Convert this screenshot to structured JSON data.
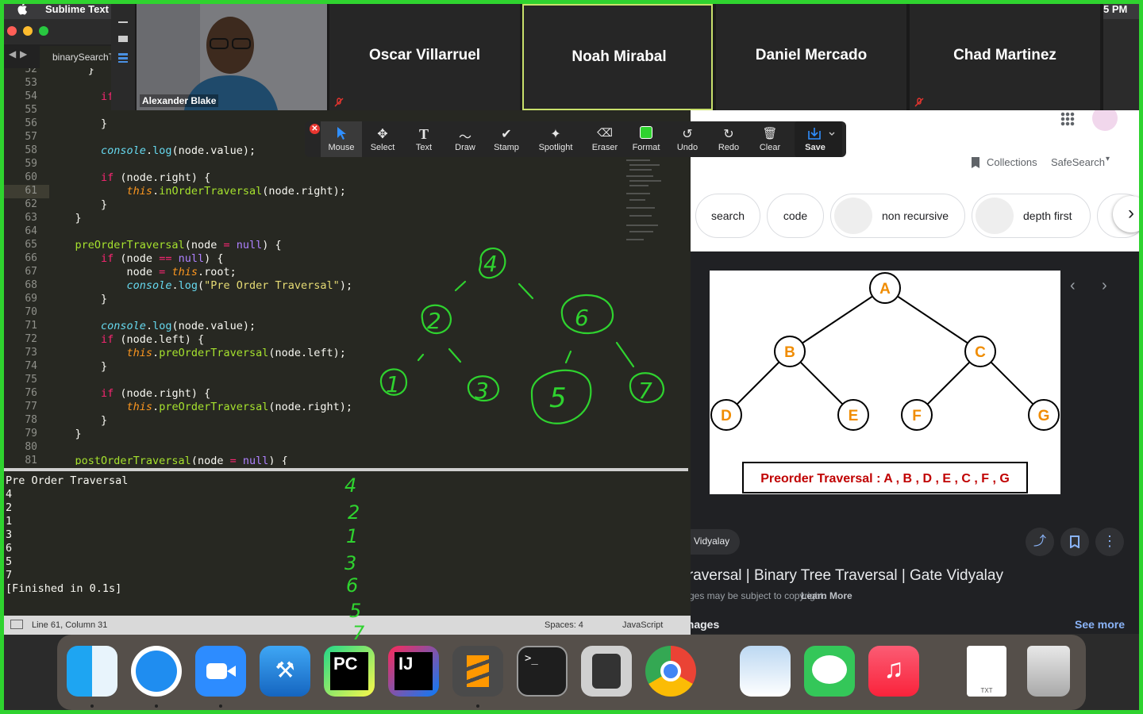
{
  "menubar": {
    "app_name": "Sublime Text",
    "clock": "5 PM"
  },
  "sublime": {
    "tab_label": "binarySearchTree.js",
    "nav_back": "◀",
    "nav_forward": "▶",
    "status_left": "Line 61, Column 31",
    "status_spaces": "Spaces: 4",
    "status_syntax": "JavaScript"
  },
  "code_lines": [
    {
      "n": "52",
      "t": "      }"
    },
    {
      "n": "53",
      "t": ""
    },
    {
      "n": "54",
      "t": "        if"
    },
    {
      "n": "55",
      "t": ""
    },
    {
      "n": "56",
      "t": "        }"
    },
    {
      "n": "57",
      "t": ""
    },
    {
      "n": "58",
      "t": "        console.log(node.value);"
    },
    {
      "n": "59",
      "t": ""
    },
    {
      "n": "60",
      "t": "        if (node.right) {"
    },
    {
      "n": "61",
      "t": "            this.inOrderTraversal(node.right);"
    },
    {
      "n": "62",
      "t": "        }"
    },
    {
      "n": "63",
      "t": "    }"
    },
    {
      "n": "64",
      "t": ""
    },
    {
      "n": "65",
      "t": "    preOrderTraversal(node = null) {"
    },
    {
      "n": "66",
      "t": "        if (node == null) {"
    },
    {
      "n": "67",
      "t": "            node = this.root;"
    },
    {
      "n": "68",
      "t": "            console.log(\"Pre Order Traversal\");"
    },
    {
      "n": "69",
      "t": "        }"
    },
    {
      "n": "70",
      "t": ""
    },
    {
      "n": "71",
      "t": "        console.log(node.value);"
    },
    {
      "n": "72",
      "t": "        if (node.left) {"
    },
    {
      "n": "73",
      "t": "            this.preOrderTraversal(node.left);"
    },
    {
      "n": "74",
      "t": "        }"
    },
    {
      "n": "75",
      "t": ""
    },
    {
      "n": "76",
      "t": "        if (node.right) {"
    },
    {
      "n": "77",
      "t": "            this.preOrderTraversal(node.right);"
    },
    {
      "n": "78",
      "t": "        }"
    },
    {
      "n": "79",
      "t": "    }"
    },
    {
      "n": "80",
      "t": ""
    },
    {
      "n": "81",
      "t": "    postOrderTraversal(node = null) {"
    }
  ],
  "output_lines": [
    "Pre Order Traversal",
    "4",
    "2",
    "1",
    "3",
    "6",
    "5",
    "7",
    "[Finished in 0.1s]"
  ],
  "handwriting": {
    "tree_nodes": [
      "4",
      "2",
      "6",
      "1",
      "3",
      "5",
      "7"
    ],
    "sequence": [
      "4",
      "2",
      "1",
      "3",
      "6",
      "5",
      "7"
    ],
    "color": "#2fd32f"
  },
  "zoom": {
    "self_name": "Alexander Blake",
    "participants": [
      "Oscar Villarruel",
      "Noah Mirabal",
      "Daniel Mercado",
      "Chad Martinez"
    ],
    "active_speaker_color": "#c8e06b"
  },
  "annotation_toolbar": {
    "close": "✕",
    "tools": [
      "Mouse",
      "Select",
      "Text",
      "Draw",
      "Stamp",
      "Spotlight",
      "Eraser",
      "Format",
      "Undo",
      "Redo",
      "Clear",
      "Save"
    ]
  },
  "google": {
    "collections": "Collections",
    "safesearch": "SafeSearch",
    "chips": [
      "search",
      "code",
      "non recursive",
      "depth first"
    ],
    "diagram_nodes": [
      "A",
      "B",
      "C",
      "D",
      "E",
      "F",
      "G"
    ],
    "diagram_caption": "Preorder Traversal : A , B , D , E , C , F , G",
    "source": "Vidyalay",
    "result_title": "Traversal | Binary Tree Traversal | Gate Vidyalay",
    "copyright": "Images may be subject to copyright.",
    "learn_more": "Learn More",
    "images_label": "Images",
    "see_more": "See more"
  },
  "dock": {
    "apps": [
      "Finder",
      "Safari",
      "Zoom",
      "Xcode",
      "PyCharm",
      "IntelliJ IDEA",
      "Sublime Text",
      "Terminal",
      "Calculator",
      "Chrome",
      "Preview",
      "Messages",
      "Music",
      "TXT",
      "Trash"
    ],
    "pycharm_label": "PC",
    "intellij_label": "IJ",
    "terminal_label": ">_",
    "txt_label": "TXT"
  },
  "colors": {
    "frame": "#2fd32f",
    "orange_node": "#f08c00",
    "caption_red": "#c00000"
  }
}
